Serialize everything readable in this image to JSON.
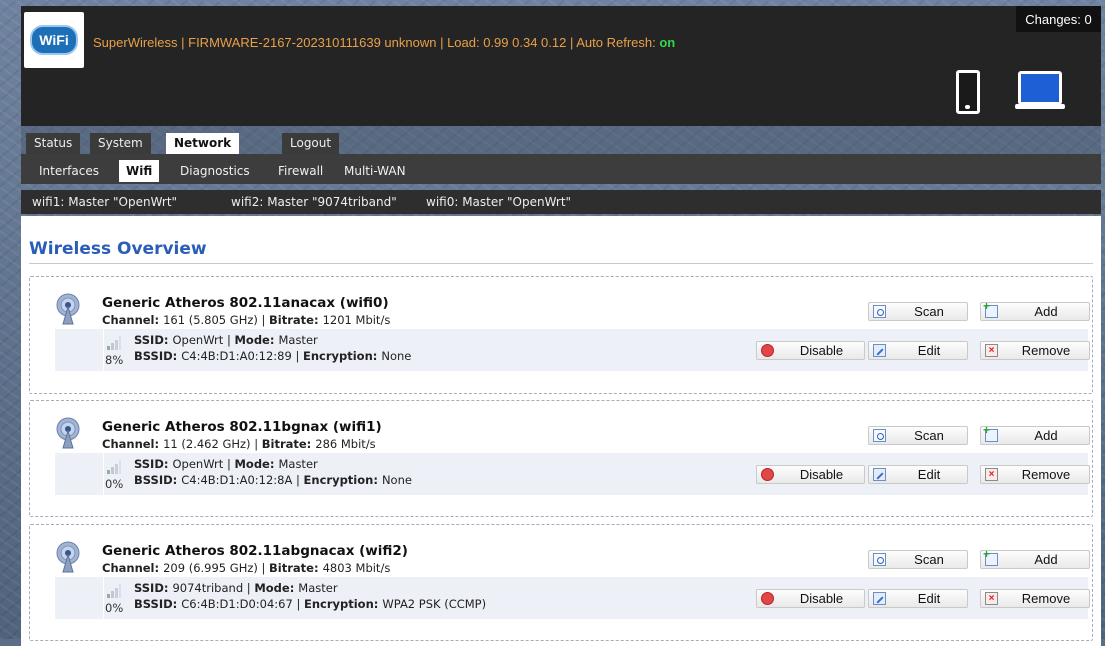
{
  "header": {
    "brand": "SuperWireless",
    "status_text": "SuperWireless | FIRMWARE-2167-202310111639 unknown | Load: 0.99 0.34 0.12 | Auto Refresh: ",
    "auto_refresh_value": "on",
    "changes_label": "Changes: 0",
    "logo_text": "WiFi"
  },
  "tabs": [
    "Status",
    "System",
    "Network",
    "Logout"
  ],
  "active_tab": "Network",
  "subtabs": [
    "Interfaces",
    "Wifi",
    "Diagnostics",
    "Firewall",
    "Multi-WAN"
  ],
  "active_subtab": "Wifi",
  "wifi_tabs": [
    "wifi1: Master \"OpenWrt\"",
    "wifi2: Master \"9074triband\"",
    "wifi0: Master \"OpenWrt\""
  ],
  "page_title": "Wireless Overview",
  "labels": {
    "channel": "Channel:",
    "bitrate": "Bitrate:",
    "ssid": "SSID:",
    "mode": "Mode:",
    "bssid": "BSSID:",
    "encryption": "Encryption:",
    "sep": "|"
  },
  "buttons": {
    "scan": "Scan",
    "add": "Add",
    "disable": "Disable",
    "edit": "Edit",
    "remove": "Remove"
  },
  "devices": [
    {
      "name": "Generic Atheros 802.11anacax (wifi0)",
      "channel": "161 (5.805 GHz)",
      "bitrate": "1201 Mbit/s",
      "signal": "8%",
      "ssid": "OpenWrt",
      "mode": "Master",
      "bssid": "C4:4B:D1:A0:12:89",
      "encryption": "None"
    },
    {
      "name": "Generic Atheros 802.11bgnax (wifi1)",
      "channel": "11 (2.462 GHz)",
      "bitrate": "286 Mbit/s",
      "signal": "0%",
      "ssid": "OpenWrt",
      "mode": "Master",
      "bssid": "C4:4B:D1:A0:12:8A",
      "encryption": "None"
    },
    {
      "name": "Generic Atheros 802.11abgnacax (wifi2)",
      "channel": "209 (6.995 GHz)",
      "bitrate": "4803 Mbit/s",
      "signal": "0%",
      "ssid": "9074triband",
      "mode": "Master",
      "bssid": "C6:4B:D1:D0:04:67",
      "encryption": "WPA2 PSK (CCMP)"
    }
  ],
  "colors": {
    "header_bg": "#242424",
    "status_text": "#e8a04a",
    "auto_refresh_on": "#33d64a",
    "title": "#2a5db8",
    "row_bg": "#eef0f8"
  }
}
